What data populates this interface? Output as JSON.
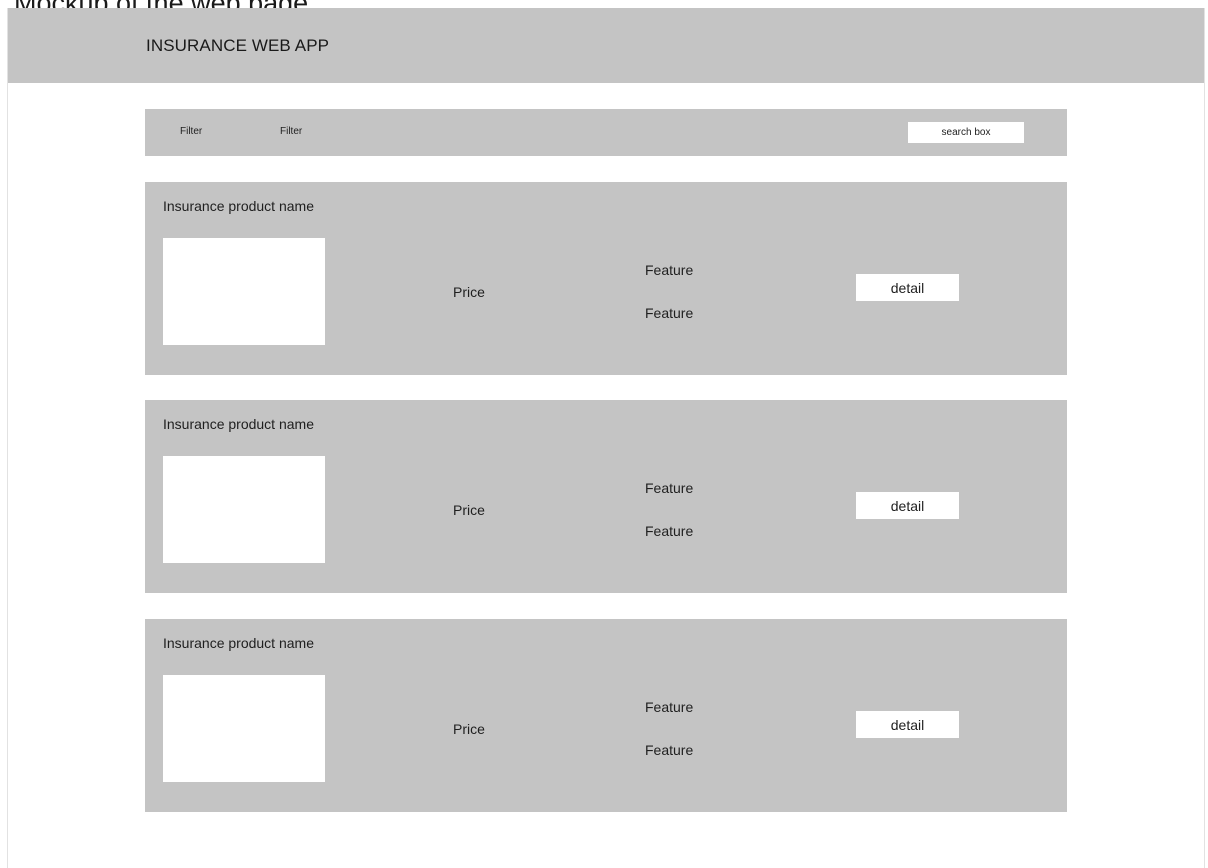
{
  "page": {
    "title": "Mockup of the web page"
  },
  "header": {
    "app_title": "INSURANCE WEB APP"
  },
  "filter_bar": {
    "filters": [
      {
        "label": "Filter"
      },
      {
        "label": "Filter"
      }
    ],
    "search": {
      "placeholder": "search box",
      "value": ""
    }
  },
  "products": [
    {
      "name": "Insurance product name",
      "price_label": "Price",
      "features": [
        "Feature",
        "Feature"
      ],
      "detail_label": "detail"
    },
    {
      "name": "Insurance product name",
      "price_label": "Price",
      "features": [
        "Feature",
        "Feature"
      ],
      "detail_label": "detail"
    },
    {
      "name": "Insurance product name",
      "price_label": "Price",
      "features": [
        "Feature",
        "Feature"
      ],
      "detail_label": "detail"
    }
  ],
  "colors": {
    "panel_gray": "#c4c4c4",
    "background": "#ffffff",
    "text": "#1f1f1f"
  }
}
